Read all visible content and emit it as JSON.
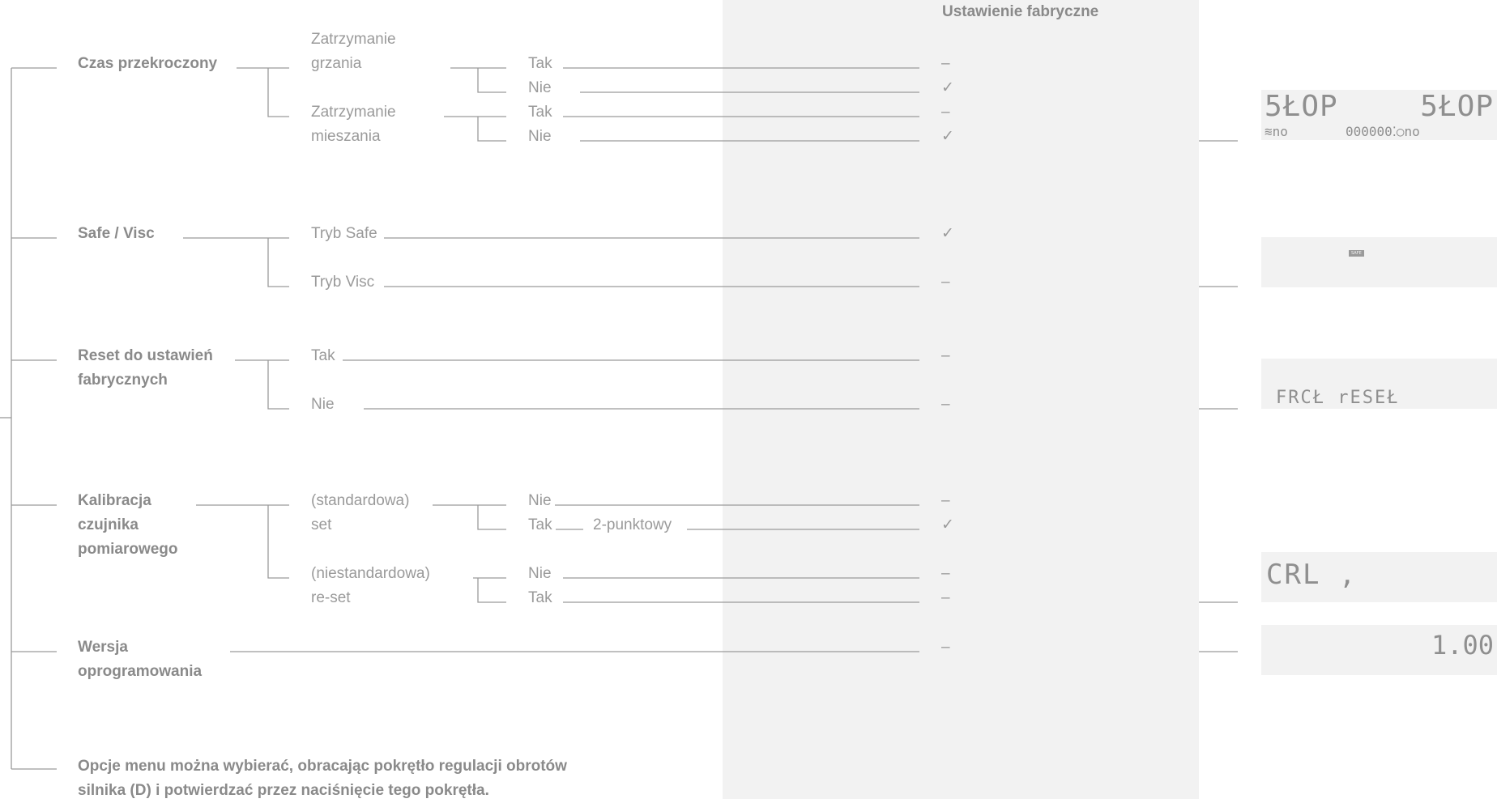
{
  "header": {
    "factory_setting": "Ustawienie fabryczne"
  },
  "groups": {
    "czas": {
      "title": "Czas przekroczony",
      "sub1_l1": "Zatrzymanie",
      "sub1_l2": "grzania",
      "sub2_l1": "Zatrzymanie",
      "sub2_l2": "mieszania",
      "opt_tak": "Tak",
      "opt_nie": "Nie",
      "values": [
        "–",
        "✓",
        "–",
        "✓"
      ]
    },
    "safe": {
      "title": "Safe / Visc",
      "opt1": "Tryb Safe",
      "opt2": "Tryb Visc",
      "values": [
        "✓",
        "–"
      ]
    },
    "reset": {
      "title_l1": "Reset do ustawień",
      "title_l2": "fabrycznych",
      "opt1": "Tak",
      "opt2": "Nie",
      "values": [
        "–",
        "–"
      ]
    },
    "kal": {
      "title_l1": "Kalibracja",
      "title_l2": "czujnika",
      "title_l3": "pomiarowego",
      "std_l1": "(standardowa)",
      "std_l2": "set",
      "nstd_l1": "(niestandardowa)",
      "nstd_l2": "re-set",
      "opt_nie": "Nie",
      "opt_tak": "Tak",
      "two_point": "2-punktowy",
      "values": [
        "–",
        "✓",
        "–",
        "–"
      ]
    },
    "wersja": {
      "title_l1": "Wersja",
      "title_l2": "oprogramowania",
      "values": [
        "–"
      ]
    }
  },
  "footer": {
    "line1": "Opcje menu można wybierać, obracając pokrętło regulacji obrotów",
    "line2": "silnika (D) i potwierdzać przez naciśnięcie tego pokrętła."
  },
  "displays": {
    "stop": {
      "left": "5ŁOP",
      "right": "5ŁOP",
      "bl": "≋no",
      "br": "000000⁚○no"
    },
    "safe": {
      "tag": "SAFE"
    },
    "reset": {
      "text": "FRCŁ  rESEŁ"
    },
    "cal": {
      "text": "CRL ,",
      "mark": ""
    },
    "version": {
      "text": "1.00"
    }
  }
}
